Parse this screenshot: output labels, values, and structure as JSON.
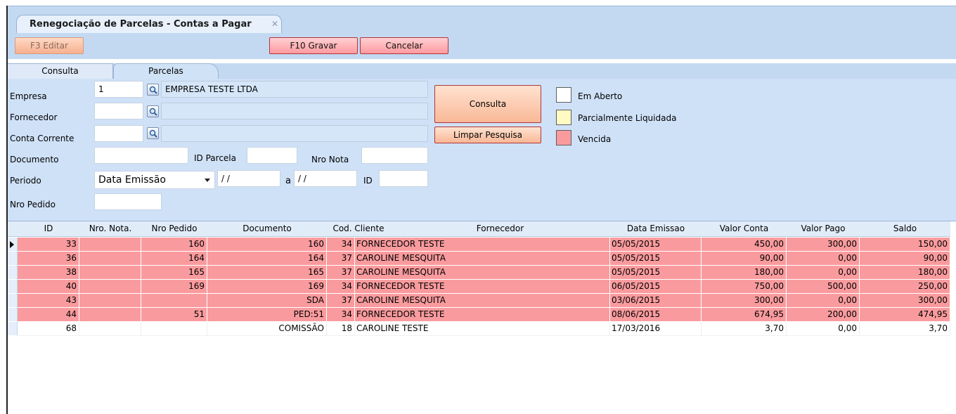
{
  "window": {
    "tab_title": "Renegociação de Parcelas - Contas a Pagar"
  },
  "toolbar": {
    "f3_label": "F3 Editar",
    "f10_label": "F10 Gravar",
    "cancel_label": "Cancelar"
  },
  "tabs": [
    {
      "label": "Consulta"
    },
    {
      "label": "Parcelas"
    }
  ],
  "form": {
    "empresa_label": "Empresa",
    "empresa_code": "1",
    "empresa_name": "EMPRESA TESTE LTDA",
    "fornecedor_label": "Fornecedor",
    "fornecedor_code": "",
    "fornecedor_name": "",
    "conta_label": "Conta Corrente",
    "conta_code": "",
    "conta_name": "",
    "documento_label": "Documento",
    "documento_value": "",
    "id_parcela_label": "ID Parcela",
    "id_parcela_value": "",
    "nro_nota_label": "Nro Nota",
    "nro_nota_value": "",
    "periodo_label": "Periodo",
    "periodo_option": "Data Emissão",
    "date_from": " / /",
    "a_label": "a",
    "date_to": " / /",
    "id_label": "ID",
    "id_value": "",
    "nro_pedido_label": "Nro Pedido",
    "nro_pedido_value": "",
    "consulta_button": "Consulta",
    "limpar_button": "Limpar Pesquisa"
  },
  "legend": [
    {
      "label": "Em Aberto",
      "color": "#ffffff"
    },
    {
      "label": "Parcialmente Liquidada",
      "color": "#fffbc2"
    },
    {
      "label": "Vencida",
      "color": "#f99b9e"
    }
  ],
  "grid": {
    "headers": [
      "ID",
      "Nro. Nota.",
      "Nro Pedido",
      "Documento",
      "Cod. Cliente",
      "Fornecedor",
      "Data Emissao",
      "Valor Conta",
      "Valor Pago",
      "Saldo"
    ],
    "rows": [
      {
        "status": "Vencida",
        "cells": [
          "33",
          "",
          "160",
          "160",
          "34",
          "FORNECEDOR TESTE",
          "05/05/2015",
          "450,00",
          "300,00",
          "150,00"
        ]
      },
      {
        "status": "Vencida",
        "cells": [
          "36",
          "",
          "164",
          "164",
          "37",
          "CAROLINE MESQUITA",
          "05/05/2015",
          "90,00",
          "0,00",
          "90,00"
        ]
      },
      {
        "status": "Vencida",
        "cells": [
          "38",
          "",
          "165",
          "165",
          "37",
          "CAROLINE MESQUITA",
          "05/05/2015",
          "180,00",
          "0,00",
          "180,00"
        ]
      },
      {
        "status": "Vencida",
        "cells": [
          "40",
          "",
          "169",
          "169",
          "34",
          "FORNECEDOR TESTE",
          "06/05/2015",
          "750,00",
          "500,00",
          "250,00"
        ]
      },
      {
        "status": "Vencida",
        "cells": [
          "43",
          "",
          "",
          "SDA",
          "37",
          "CAROLINE MESQUITA",
          "03/06/2015",
          "300,00",
          "0,00",
          "300,00"
        ]
      },
      {
        "status": "Vencida",
        "cells": [
          "44",
          "",
          "51",
          "PED:51",
          "34",
          "FORNECEDOR TESTE",
          "08/06/2015",
          "674,95",
          "200,00",
          "474,95"
        ]
      },
      {
        "status": "Em Aberto",
        "cells": [
          "68",
          "",
          "",
          "COMISSÃO",
          "18",
          "CAROLINE TESTE",
          "17/03/2016",
          "3,70",
          "0,00",
          "3,70"
        ]
      }
    ]
  }
}
